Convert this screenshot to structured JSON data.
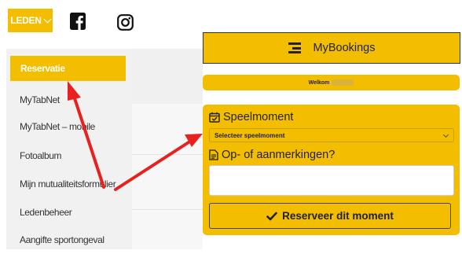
{
  "topbar": {
    "leden_label": "LEDEN"
  },
  "menu": {
    "items": [
      {
        "label": "Reservatie",
        "active": true
      },
      {
        "label": "MyTabNet"
      },
      {
        "label": "MyTabNet – mobile"
      },
      {
        "label": "Fotoalbum"
      },
      {
        "label": "Mijn mutualiteitsformulier"
      },
      {
        "label": "Ledenbeheer"
      },
      {
        "label": "Aangifte sportongeval"
      }
    ]
  },
  "panel": {
    "title": "MyBookings",
    "welcome": "Welkom",
    "speelmoment_label": "Speelmoment",
    "select_value": "Selecteer speelmoment",
    "remarks_label": "Op- of aanmerkingen?",
    "remarks_value": "",
    "submit_label": "Reserveer dit moment"
  },
  "colors": {
    "accent": "#f3bd00",
    "arrow": "#e8211e"
  }
}
